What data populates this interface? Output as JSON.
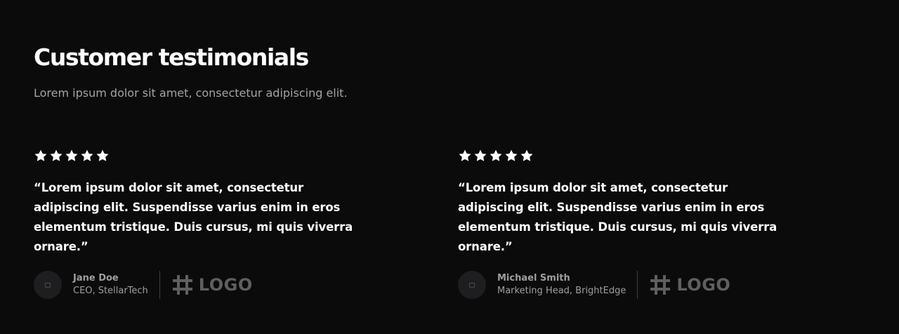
{
  "section": {
    "title": "Customer testimonials",
    "subtitle": "Lorem ipsum dolor sit amet, consectetur adipiscing elit."
  },
  "testimonials": [
    {
      "rating": 5,
      "quote": "“Lorem ipsum dolor sit amet, consectetur adipiscing elit. Suspendisse varius enim in eros elementum tristique. Duis cursus, mi quis viverra ornare.”",
      "name": "Jane Doe",
      "role": "CEO, StellarTech",
      "logo_text": "LOGO",
      "avatar_icon": "image-placeholder-icon",
      "logo_icon": "hash-icon"
    },
    {
      "rating": 5,
      "quote": "“Lorem ipsum dolor sit amet, consectetur adipiscing elit. Suspendisse varius enim in eros elementum tristique. Duis cursus, mi quis viverra ornare.”",
      "name": "Michael Smith",
      "role": "Marketing Head, BrightEdge",
      "logo_text": "LOGO",
      "avatar_icon": "image-placeholder-icon",
      "logo_icon": "hash-icon"
    }
  ],
  "colors": {
    "background": "#0b0b0c",
    "heading": "#ffffff",
    "muted_text": "#9e9e9e",
    "logo": "#5f5f61"
  }
}
